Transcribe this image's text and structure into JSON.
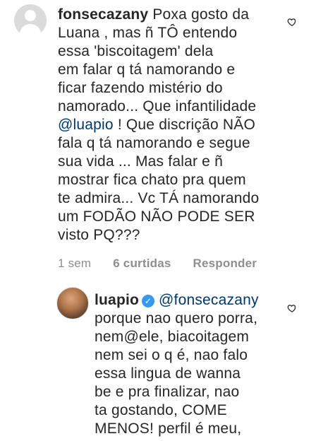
{
  "comments": [
    {
      "username": "fonsecazany",
      "first_line_text": "Poxa gosto da",
      "lines": [
        "Luana , mas ñ TÔ entendo",
        "essa 'biscoitagem' dela",
        "em falar q tá namorando e",
        "ficar fazendo mistério do",
        "namorado... Que infantilidade"
      ],
      "mention": "@luapio",
      "mention_rest": " ! Que discrição NÃO",
      "lines_after": [
        "fala q tá namorando e segue",
        "sua vida ... Mas falar e ñ",
        "mostrar fica chato pra quem",
        "te admira... Vc TÁ namorando",
        "um FODÃO NÃO PODE SER",
        "visto PQ???"
      ],
      "time": "1 sem",
      "likes": "6 curtidas",
      "reply_label": "Responder",
      "avatar_icon": "default-avatar-icon",
      "like_icon": "heart-outline-icon"
    },
    {
      "username": "luapio",
      "verified_icon": "verified-badge-icon",
      "mention": "@fonsecazany",
      "lines": [
        "porque nao quero porra,",
        "nem@ele, biacoitagem",
        "nem sei o q é, nao falo",
        "essa lingua de wanna",
        "be e pra finalizar, nao",
        "ta gostando, COME",
        "MENOS! perfil é meu,"
      ],
      "avatar_icon": "profile-photo-avatar",
      "like_icon": "heart-outline-icon"
    }
  ],
  "colors": {
    "text": "#262626",
    "meta": "#8e8e8e",
    "mention": "#00376b",
    "verified": "#3897f0"
  }
}
